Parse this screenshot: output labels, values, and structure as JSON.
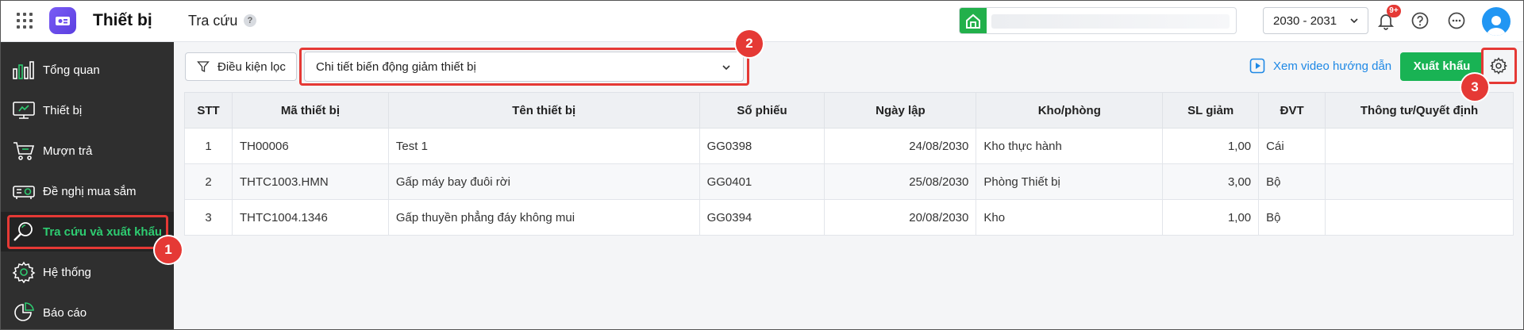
{
  "app": {
    "title": "Thiết bị"
  },
  "header": {
    "page_title": "Tra cứu",
    "help_mark": "?",
    "year": "2030 - 2031",
    "notification_count": "9+"
  },
  "sidebar": {
    "items": [
      {
        "label": "Tổng quan",
        "icon": "bar-chart-icon"
      },
      {
        "label": "Thiết bị",
        "icon": "monitor-icon"
      },
      {
        "label": "Mượn trả",
        "icon": "cart-icon"
      },
      {
        "label": "Đề nghị mua sắm",
        "icon": "projector-icon"
      },
      {
        "label": "Tra cứu và xuất khẩu",
        "icon": "search-icon",
        "active": true
      },
      {
        "label": "Hệ thống",
        "icon": "gear-icon"
      },
      {
        "label": "Báo cáo",
        "icon": "pie-chart-icon"
      }
    ]
  },
  "toolbar": {
    "filter_label": "Điều kiện lọc",
    "report_type": "Chi tiết biến động giảm thiết bị",
    "video_link": "Xem video hướng dẫn",
    "export_label": "Xuất khẩu"
  },
  "callouts": [
    "1",
    "2",
    "3"
  ],
  "table": {
    "headers": [
      "STT",
      "Mã thiết bị",
      "Tên thiết bị",
      "Số phiếu",
      "Ngày lập",
      "Kho/phòng",
      "SL giảm",
      "ĐVT",
      "Thông tư/Quyết định"
    ],
    "rows": [
      [
        "1",
        "TH00006",
        "Test 1",
        "GG0398",
        "24/08/2030",
        "Kho thực hành",
        "1,00",
        "Cái",
        ""
      ],
      [
        "2",
        "THTC1003.HMN",
        "Gấp máy bay đuôi rời",
        "GG0401",
        "25/08/2030",
        "Phòng Thiết bị",
        "3,00",
        "Bộ",
        ""
      ],
      [
        "3",
        "THTC1004.1346",
        "Gấp thuyền phẳng đáy không mui",
        "GG0394",
        "20/08/2030",
        "Kho",
        "1,00",
        "Bộ",
        ""
      ]
    ]
  },
  "colors": {
    "accent_green": "#19b354",
    "callout_red": "#e53935",
    "sidebar_bg": "#2f2f2f",
    "link_blue": "#1e88e5"
  }
}
